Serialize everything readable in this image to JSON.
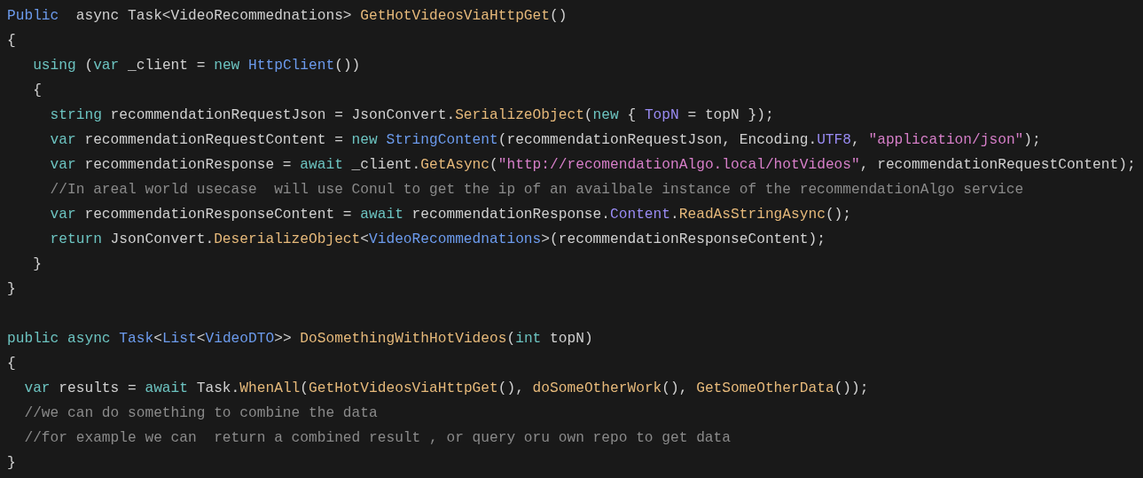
{
  "editor": {
    "methods": [
      {
        "lines": [
          [
            {
              "kind": "type",
              "text": "Public"
            },
            {
              "kind": "plain",
              "text": "  async Task<VideoRecommednations> "
            },
            {
              "kind": "method",
              "text": "GetHotVideosViaHttpGet"
            },
            {
              "kind": "plain",
              "text": "()"
            }
          ],
          [
            {
              "kind": "plain",
              "text": "{"
            }
          ],
          [
            {
              "kind": "keyword",
              "text": "   using"
            },
            {
              "kind": "plain",
              "text": " ("
            },
            {
              "kind": "keyword",
              "text": "var"
            },
            {
              "kind": "plain",
              "text": " _client = "
            },
            {
              "kind": "keyword",
              "text": "new "
            },
            {
              "kind": "type",
              "text": "HttpClient"
            },
            {
              "kind": "plain",
              "text": "())"
            }
          ],
          [
            {
              "kind": "plain",
              "text": "   {"
            }
          ],
          [
            {
              "kind": "keyword",
              "text": "     string"
            },
            {
              "kind": "plain",
              "text": " recommendationRequestJson = JsonConvert."
            },
            {
              "kind": "method",
              "text": "SerializeObject"
            },
            {
              "kind": "plain",
              "text": "("
            },
            {
              "kind": "keyword",
              "text": "new"
            },
            {
              "kind": "plain",
              "text": " { "
            },
            {
              "kind": "property",
              "text": "TopN"
            },
            {
              "kind": "plain",
              "text": " = topN });"
            }
          ],
          [
            {
              "kind": "keyword",
              "text": "     var"
            },
            {
              "kind": "plain",
              "text": " recommendationRequestContent = "
            },
            {
              "kind": "keyword",
              "text": "new "
            },
            {
              "kind": "type",
              "text": "StringContent"
            },
            {
              "kind": "plain",
              "text": "(recommendationRequestJson, Encoding."
            },
            {
              "kind": "property",
              "text": "UTF8"
            },
            {
              "kind": "plain",
              "text": ", "
            },
            {
              "kind": "string",
              "text": "\"application/json\""
            },
            {
              "kind": "plain",
              "text": ");"
            }
          ],
          [
            {
              "kind": "keyword",
              "text": "     var"
            },
            {
              "kind": "plain",
              "text": " recommendationResponse = "
            },
            {
              "kind": "keyword",
              "text": "await"
            },
            {
              "kind": "plain",
              "text": " _client."
            },
            {
              "kind": "method",
              "text": "GetAsync"
            },
            {
              "kind": "plain",
              "text": "("
            },
            {
              "kind": "string",
              "text": "\"http://recomendationAlgo.local/hotVideos\""
            },
            {
              "kind": "plain",
              "text": ", recommendationRequestContent);"
            }
          ],
          [
            {
              "kind": "comment",
              "text": "     //In areal world usecase  will use Conul to get the ip of an availbale instance of the recommendationAlgo service"
            }
          ],
          [
            {
              "kind": "keyword",
              "text": "     var"
            },
            {
              "kind": "plain",
              "text": " recommendationResponseContent = "
            },
            {
              "kind": "keyword",
              "text": "await"
            },
            {
              "kind": "plain",
              "text": " recommendationResponse."
            },
            {
              "kind": "property",
              "text": "Content"
            },
            {
              "kind": "plain",
              "text": "."
            },
            {
              "kind": "method",
              "text": "ReadAsStringAsync"
            },
            {
              "kind": "plain",
              "text": "();"
            }
          ],
          [
            {
              "kind": "keyword",
              "text": "     return"
            },
            {
              "kind": "plain",
              "text": " JsonConvert."
            },
            {
              "kind": "method",
              "text": "DeserializeObject"
            },
            {
              "kind": "plain",
              "text": "<"
            },
            {
              "kind": "type",
              "text": "VideoRecommednations"
            },
            {
              "kind": "plain",
              "text": ">(recommendationResponseContent);"
            }
          ],
          [
            {
              "kind": "plain",
              "text": "   }"
            }
          ],
          [
            {
              "kind": "plain",
              "text": "}"
            }
          ]
        ]
      },
      {
        "lines": [
          [
            {
              "kind": "keyword",
              "text": "public "
            },
            {
              "kind": "keyword",
              "text": "async "
            },
            {
              "kind": "type",
              "text": "Task"
            },
            {
              "kind": "plain",
              "text": "<"
            },
            {
              "kind": "type",
              "text": "List"
            },
            {
              "kind": "plain",
              "text": "<"
            },
            {
              "kind": "type",
              "text": "VideoDTO"
            },
            {
              "kind": "plain",
              "text": ">> "
            },
            {
              "kind": "method",
              "text": "DoSomethingWithHotVideos"
            },
            {
              "kind": "plain",
              "text": "("
            },
            {
              "kind": "keyword",
              "text": "int"
            },
            {
              "kind": "plain",
              "text": " topN)"
            }
          ],
          [
            {
              "kind": "plain",
              "text": "{"
            }
          ],
          [
            {
              "kind": "keyword",
              "text": "  var"
            },
            {
              "kind": "plain",
              "text": " results = "
            },
            {
              "kind": "keyword",
              "text": "await"
            },
            {
              "kind": "plain",
              "text": " Task."
            },
            {
              "kind": "method",
              "text": "WhenAll"
            },
            {
              "kind": "plain",
              "text": "("
            },
            {
              "kind": "method",
              "text": "GetHotVideosViaHttpGet"
            },
            {
              "kind": "plain",
              "text": "(), "
            },
            {
              "kind": "method",
              "text": "doSomeOtherWork"
            },
            {
              "kind": "plain",
              "text": "(), "
            },
            {
              "kind": "method",
              "text": "GetSomeOtherData"
            },
            {
              "kind": "plain",
              "text": "());"
            }
          ],
          [
            {
              "kind": "comment",
              "text": "  //we can do something to combine the data"
            }
          ],
          [
            {
              "kind": "comment",
              "text": "  //for example we can  return a combined result , or query oru own repo to get data"
            }
          ],
          [
            {
              "kind": "plain",
              "text": "}"
            }
          ]
        ]
      }
    ]
  }
}
